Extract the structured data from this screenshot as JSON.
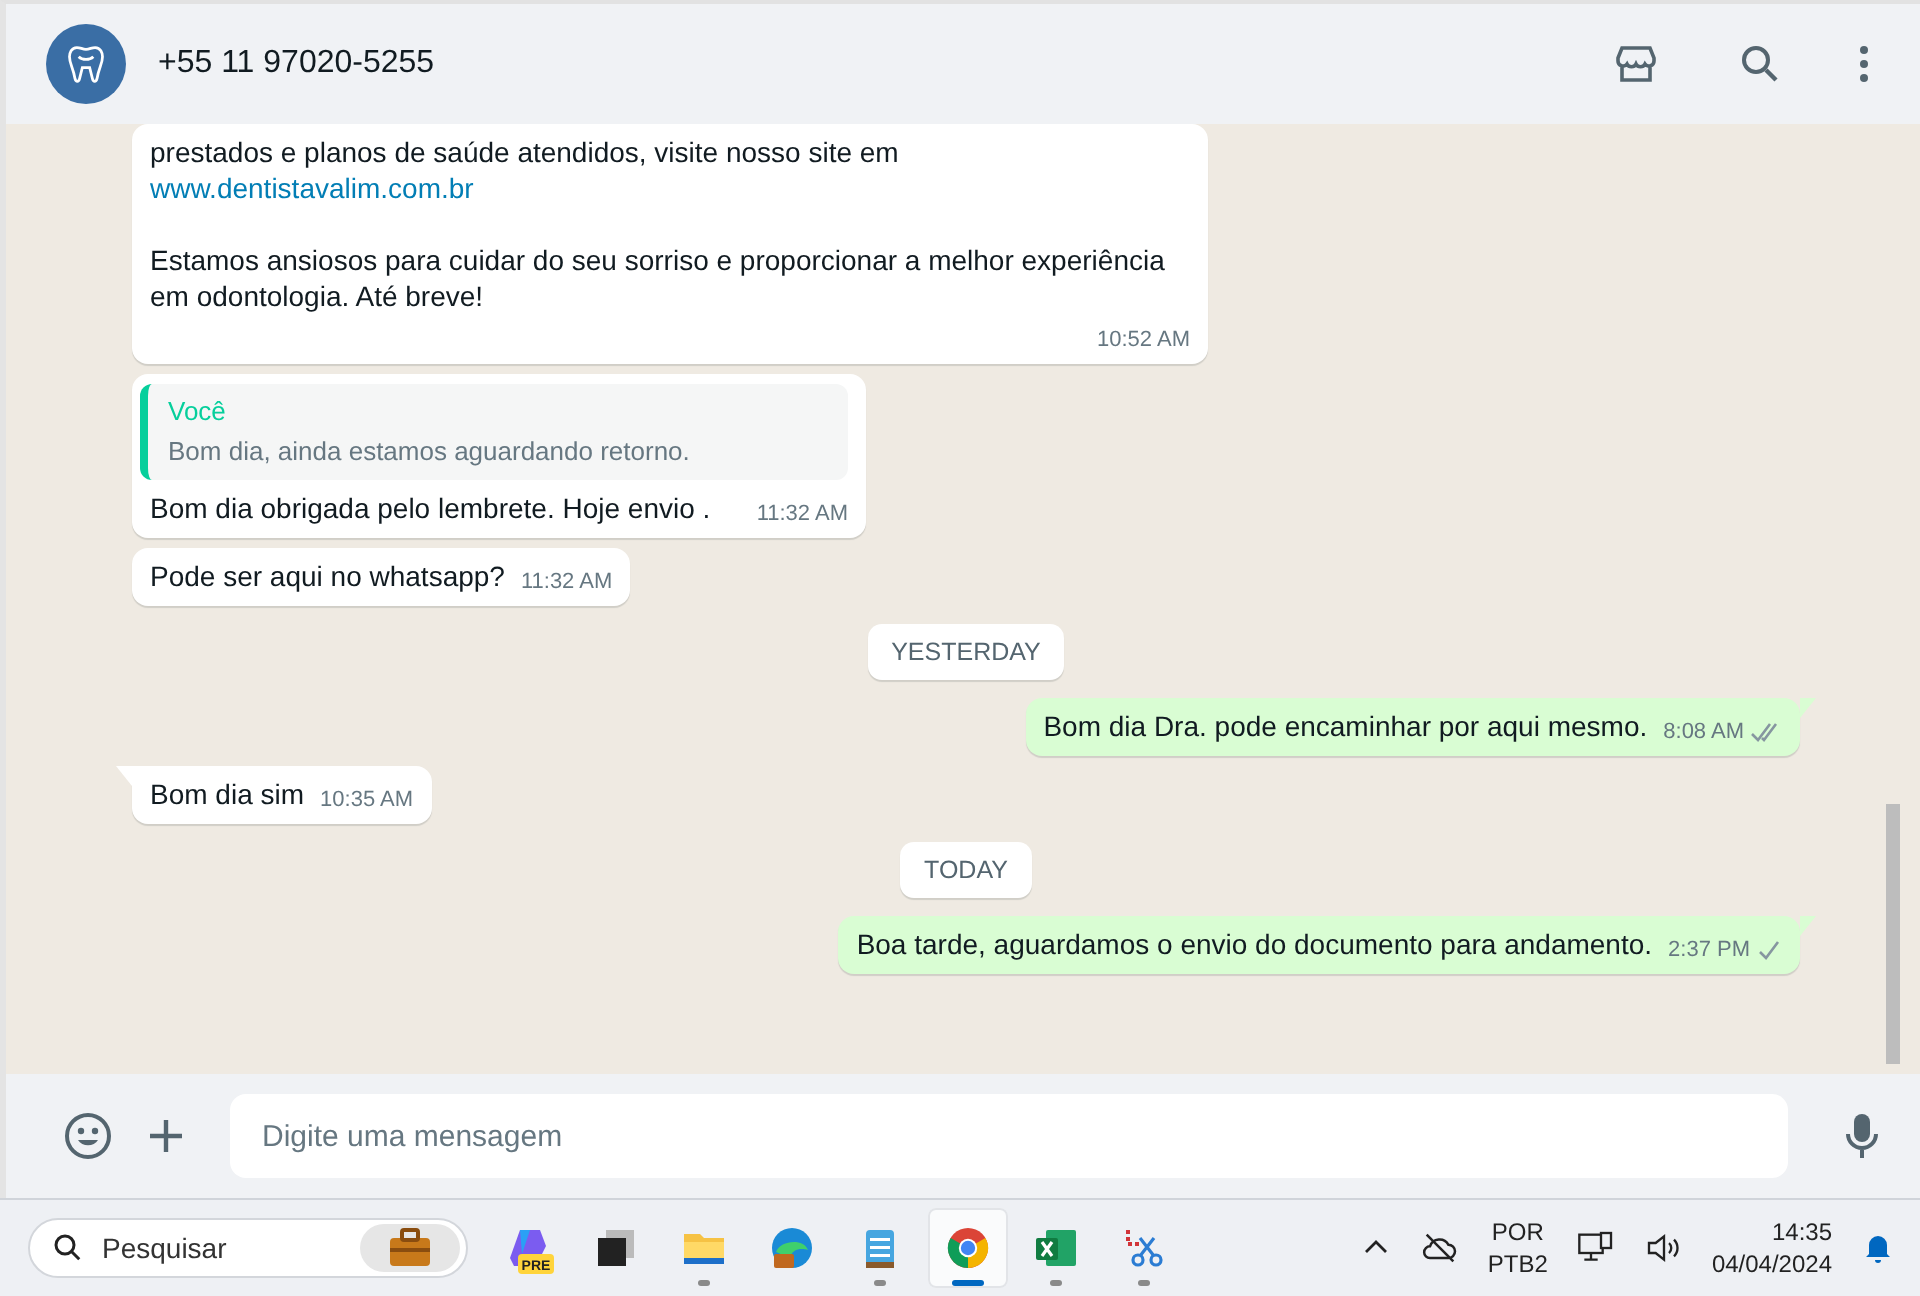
{
  "header": {
    "contact": "+55 11 97020-5255"
  },
  "messages": [
    {
      "kind": "incoming",
      "tail": false,
      "paragraphs": [
        {
          "text": "prestados e planos de saúde atendidos, visite nosso site em",
          "link": "www.dentistavalim.com.br"
        },
        {
          "text": "Estamos ansiosos para cuidar do seu sorriso e proporcionar a melhor experiência em odontologia. Até breve!"
        }
      ],
      "time": "10:52 AM"
    },
    {
      "kind": "incoming",
      "tail": false,
      "quote": {
        "author": "Você",
        "text": "Bom dia, ainda estamos aguardando retorno."
      },
      "paragraphs": [
        {
          "text": "Bom dia obrigada pelo lembrete. Hoje envio ."
        }
      ],
      "time": "11:32 AM"
    },
    {
      "kind": "incoming",
      "tail": false,
      "paragraphs": [
        {
          "text": "Pode ser aqui no whatsapp?"
        }
      ],
      "time": "11:32 AM"
    },
    {
      "kind": "date",
      "text": "YESTERDAY"
    },
    {
      "kind": "outgoing",
      "tail": true,
      "paragraphs": [
        {
          "text": "Bom dia Dra. pode encaminhar por aqui mesmo."
        }
      ],
      "time": "8:08 AM",
      "double_tick": true
    },
    {
      "kind": "incoming",
      "tail": true,
      "paragraphs": [
        {
          "text": "Bom dia sim"
        }
      ],
      "time": "10:35 AM"
    },
    {
      "kind": "date",
      "text": "TODAY"
    },
    {
      "kind": "outgoing",
      "tail": true,
      "paragraphs": [
        {
          "text": "Boa tarde, aguardamos o envio do documento para andamento."
        }
      ],
      "time": "2:37 PM",
      "double_tick": false
    }
  ],
  "composer": {
    "placeholder": "Digite uma mensagem"
  },
  "taskbar": {
    "search_placeholder": "Pesquisar",
    "apps": [
      {
        "kind": "copilot",
        "badge": "PRE",
        "selected": false,
        "running": false
      },
      {
        "kind": "taskview",
        "selected": false,
        "running": false
      },
      {
        "kind": "files",
        "selected": false,
        "running": true
      },
      {
        "kind": "edge",
        "selected": false,
        "running": false
      },
      {
        "kind": "notepad",
        "selected": false,
        "running": true
      },
      {
        "kind": "chrome",
        "selected": true,
        "running": true
      },
      {
        "kind": "excel",
        "selected": false,
        "running": true
      },
      {
        "kind": "snip",
        "selected": false,
        "running": true
      }
    ],
    "language": "POR",
    "layout": "PTB2",
    "time": "14:35",
    "date": "04/04/2024"
  }
}
